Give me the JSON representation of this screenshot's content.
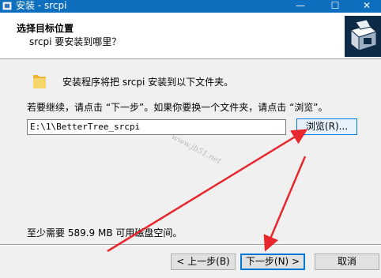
{
  "window": {
    "title": "安装 - srcpi",
    "minimize_glyph": "—",
    "maximize_glyph": "☐",
    "close_glyph": "✕"
  },
  "header": {
    "title": "选择目标位置",
    "subtitle": "srcpi 要安装到哪里？"
  },
  "body": {
    "intro": "安装程序将把 srcpi 安装到以下文件夹。",
    "instruction": "若要继续，请点击 “下一步”。如果你要换一个文件夹，请点击 “浏览”。",
    "path_value": "E:\\1\\BetterTree_srcpi",
    "browse_label": "浏览(R)...",
    "watermark": "www.jb51.net",
    "space_required": "至少需要 589.9 MB 可用磁盘空间。"
  },
  "footer": {
    "back_label": "< 上一步(B)",
    "next_label": "下一步(N) >",
    "cancel_label": "取消"
  },
  "colors": {
    "titlebar": "#0e6fbf",
    "accent": "#0078d7",
    "arrow": "#e8262d",
    "logo_bg": "#0d2a47"
  },
  "icons": {
    "app": "installer-icon",
    "folder": "folder-icon",
    "logo": "installer-box-logo"
  }
}
